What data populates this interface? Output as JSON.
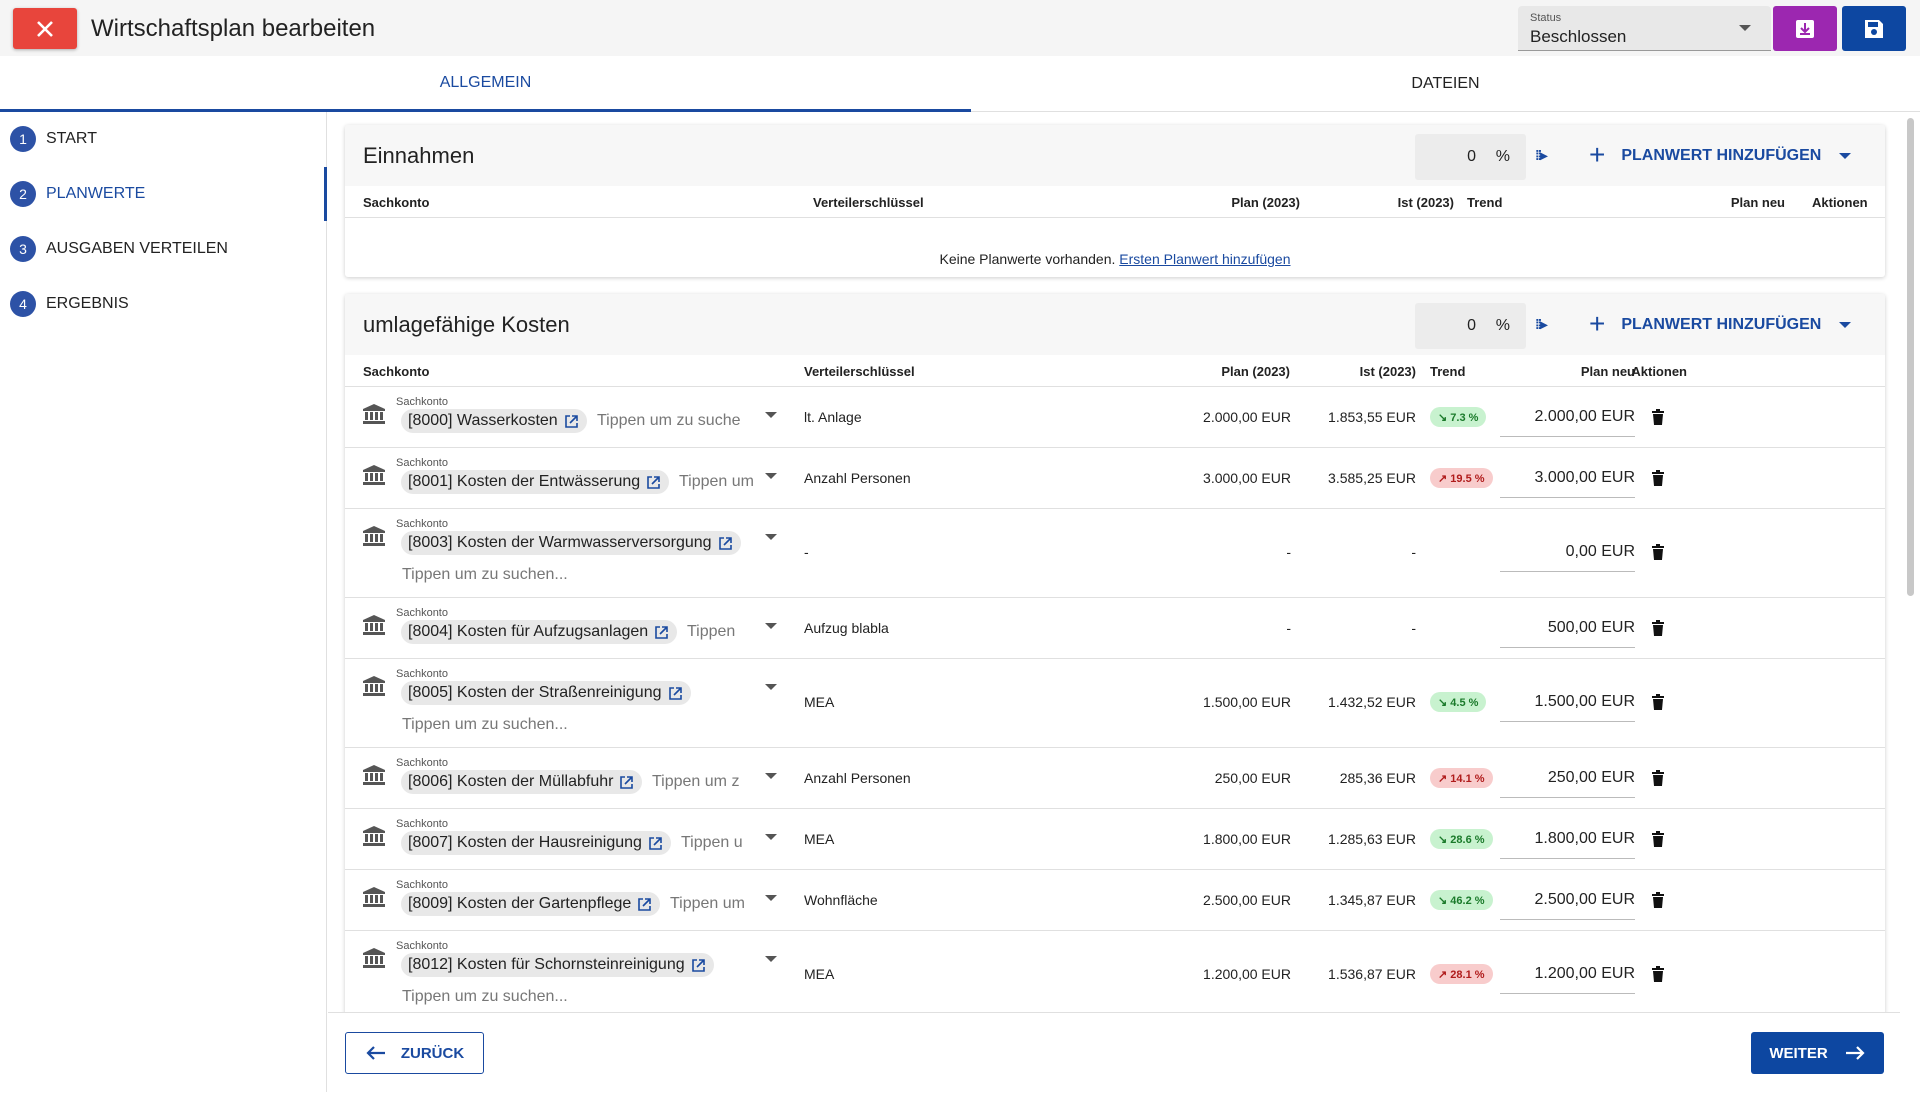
{
  "header": {
    "title": "Wirtschaftsplan bearbeiten",
    "status_label": "Status",
    "status_value": "Beschlossen"
  },
  "tabs": [
    {
      "label": "ALLGEMEIN"
    },
    {
      "label": "DATEIEN"
    }
  ],
  "steps": [
    {
      "num": "1",
      "label": "START"
    },
    {
      "num": "2",
      "label": "PLANWERTE"
    },
    {
      "num": "3",
      "label": "AUSGABEN VERTEILEN"
    },
    {
      "num": "4",
      "label": "ERGEBNIS"
    }
  ],
  "columns": {
    "sachkonto": "Sachkonto",
    "verteiler": "Verteilerschlüssel",
    "plan": "Plan (2023)",
    "ist": "Ist (2023)",
    "trend": "Trend",
    "plan_neu": "Plan neu",
    "aktionen": "Aktionen"
  },
  "einnahmen": {
    "title": "Einnahmen",
    "percent": "0",
    "percent_sign": "%",
    "add_label": "PLANWERT HINZUFÜGEN",
    "empty_text": "Keine Planwerte vorhanden.",
    "empty_link": "Ersten Planwert hinzufügen"
  },
  "kosten": {
    "title": "umlagefähige Kosten",
    "percent": "0",
    "percent_sign": "%",
    "add_label": "PLANWERT HINZUFÜGEN",
    "sk_label": "Sachkonto",
    "rows": [
      {
        "konto": "[8000] Wasserkosten",
        "tip": "Tippen um zu suche",
        "vk": "lt. Anlage",
        "plan": "2.000,00 EUR",
        "ist": "1.853,55 EUR",
        "trend": "↘ 7.3 %",
        "plan_neu": "2.000,00 EUR"
      },
      {
        "konto": "[8001] Kosten der Entwässerung",
        "tip": "Tippen um",
        "vk": "Anzahl Personen",
        "plan": "3.000,00 EUR",
        "ist": "3.585,25 EUR",
        "trend": "↗ 19.5 %",
        "plan_neu": "3.000,00 EUR"
      },
      {
        "konto": "[8003] Kosten der Warmwasserversorgung",
        "tip": "Tippen um zu suchen...",
        "vk": "-",
        "plan": "-",
        "ist": "-",
        "trend": "",
        "plan_neu": "0,00 EUR"
      },
      {
        "konto": "[8004] Kosten für Aufzugsanlagen",
        "tip": "Tippen",
        "vk": "Aufzug blabla",
        "plan": "-",
        "ist": "-",
        "trend": "",
        "plan_neu": "500,00 EUR"
      },
      {
        "konto": "[8005] Kosten der Straßenreinigung",
        "tip": "Tippen um zu suchen...",
        "vk": "MEA",
        "plan": "1.500,00 EUR",
        "ist": "1.432,52 EUR",
        "trend": "↘ 4.5 %",
        "plan_neu": "1.500,00 EUR"
      },
      {
        "konto": "[8006] Kosten der Müllabfuhr",
        "tip": "Tippen um z",
        "vk": "Anzahl Personen",
        "plan": "250,00 EUR",
        "ist": "285,36 EUR",
        "trend": "↗ 14.1 %",
        "plan_neu": "250,00 EUR"
      },
      {
        "konto": "[8007] Kosten der Hausreinigung",
        "tip": "Tippen u",
        "vk": "MEA",
        "plan": "1.800,00 EUR",
        "ist": "1.285,63 EUR",
        "trend": "↘ 28.6 %",
        "plan_neu": "1.800,00 EUR"
      },
      {
        "konto": "[8009] Kosten der Gartenpflege",
        "tip": "Tippen um",
        "vk": "Wohnfläche",
        "plan": "2.500,00 EUR",
        "ist": "1.345,87 EUR",
        "trend": "↘ 46.2 %",
        "plan_neu": "2.500,00 EUR"
      },
      {
        "konto": "[8012] Kosten für Schornsteinreinigung",
        "tip": "Tippen um zu suchen...",
        "vk": "MEA",
        "plan": "1.200,00 EUR",
        "ist": "1.536,87 EUR",
        "trend": "↗ 28.1 %",
        "plan_neu": "1.200,00 EUR"
      }
    ]
  },
  "footer": {
    "back_label": "ZURÜCK",
    "next_label": "WEITER"
  },
  "colors": {
    "primary": "#0d47a1",
    "danger": "#e8453c",
    "export": "#9c27b0",
    "trend_down_bg": "#c8f2cf",
    "trend_up_bg": "#f8cccc"
  }
}
